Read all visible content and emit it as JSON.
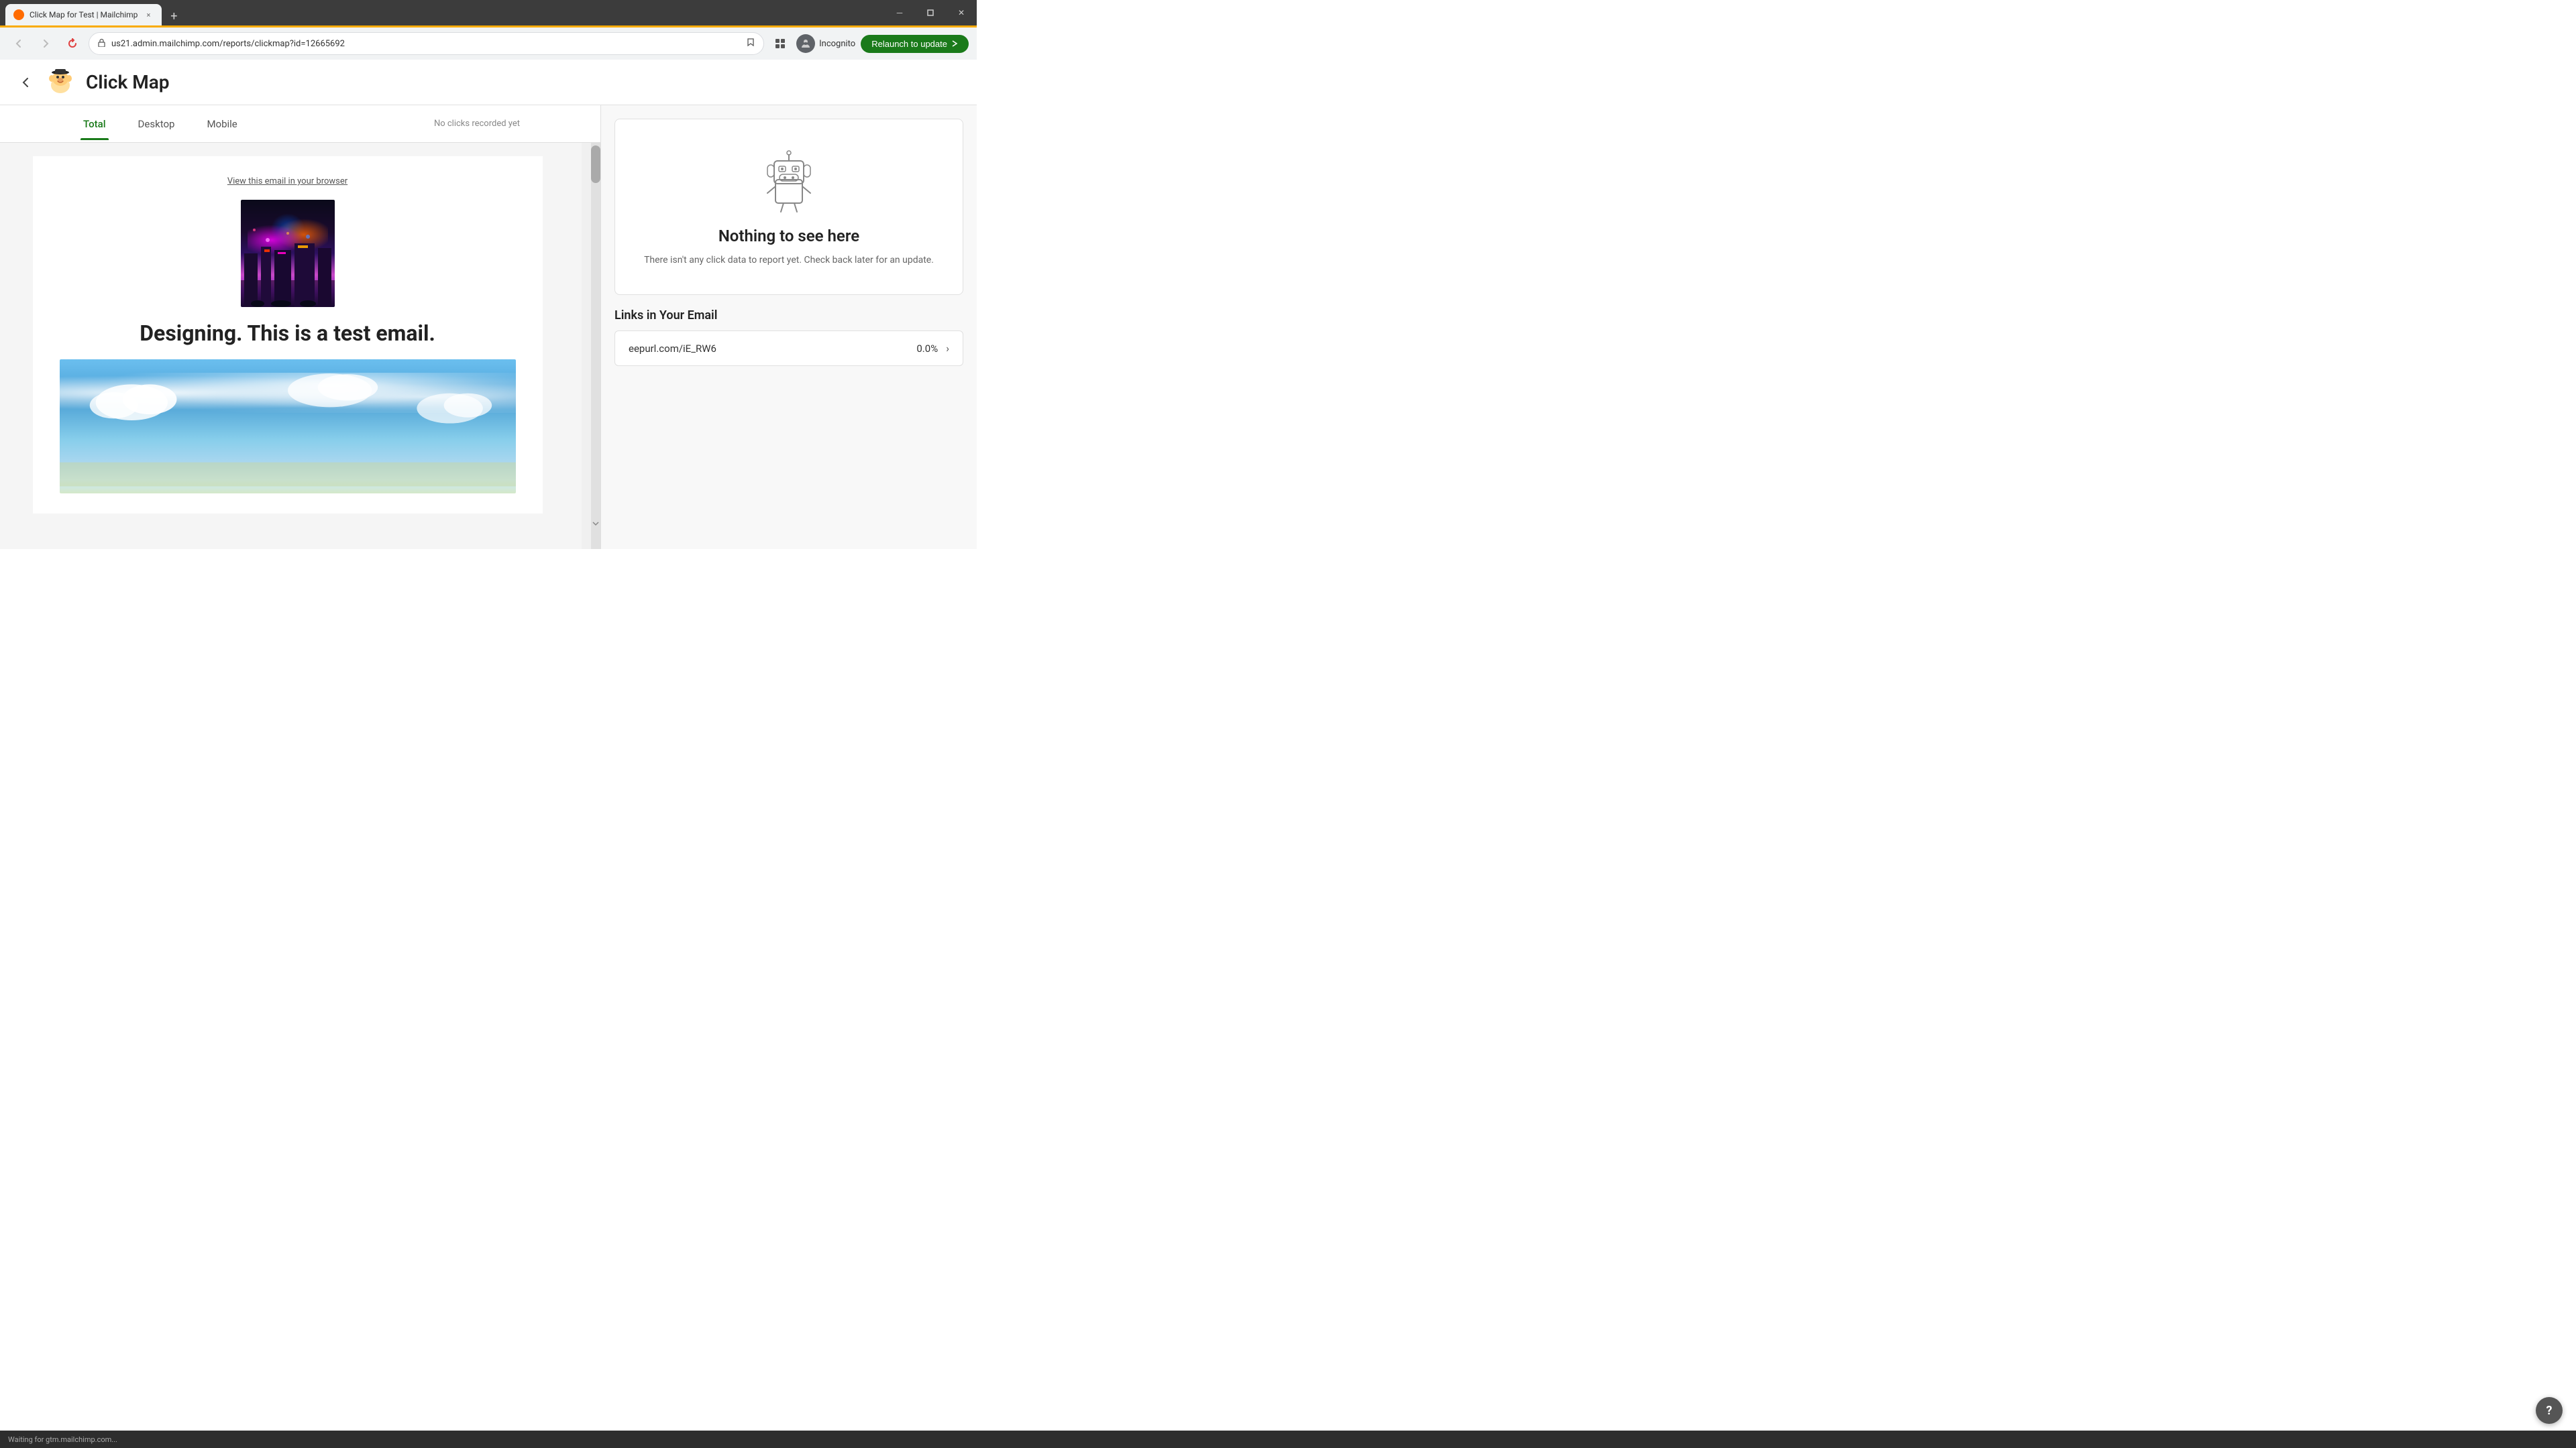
{
  "browser": {
    "tab": {
      "title": "Click Map for Test | Mailchimp",
      "favicon": "🐵",
      "close_label": "×",
      "new_tab_label": "+"
    },
    "address": "us21.admin.mailchimp.com/reports/clickmap?id=12665692",
    "incognito_label": "Incognito",
    "relaunch_label": "Relaunch to update",
    "window_controls": {
      "minimize": "─",
      "maximize": "□",
      "close": "✕"
    }
  },
  "app": {
    "back_label": "‹",
    "logo_alt": "Mailchimp logo",
    "page_title": "Click Map"
  },
  "tabs": {
    "items": [
      {
        "label": "Total",
        "active": true
      },
      {
        "label": "Desktop",
        "active": false
      },
      {
        "label": "Mobile",
        "active": false
      }
    ],
    "no_clicks_text": "No clicks recorded yet"
  },
  "email_preview": {
    "view_browser_link": "View this email in your browser",
    "heading": "Designing. This is a test email."
  },
  "right_panel": {
    "empty_state": {
      "title": "Nothing to see here",
      "description": "There isn't any click data to report yet. Check back later for an update."
    },
    "links_section": {
      "title": "Links in Your Email",
      "items": [
        {
          "url": "eepurl.com/iE_RW6",
          "percent": "0.0%"
        }
      ]
    }
  },
  "status_bar": {
    "text": "Waiting for gtm.mailchimp.com..."
  },
  "help_btn_label": "?"
}
